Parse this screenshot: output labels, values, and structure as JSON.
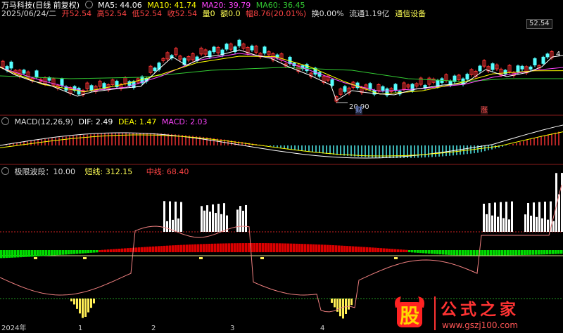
{
  "header": {
    "title": "万马科技(日线 前复权)",
    "ma": [
      {
        "label": "MA5: 44.06",
        "color": "#ffffff"
      },
      {
        "label": "MA10: 41.74",
        "color": "#ffff00"
      },
      {
        "label": "MA20: 39.79",
        "color": "#ff44ff"
      },
      {
        "label": "MA60: 36.45",
        "color": "#33cc33"
      }
    ]
  },
  "quote": {
    "date": "2025/06/24/二",
    "open": "开52.54",
    "high": "高52.54",
    "low": "低52.54",
    "close": "收52.54",
    "vol": "量0",
    "amt": "额0.0",
    "chg": "幅8.76(20.01%)",
    "turn": "换0.00%",
    "float": "流通1.19亿",
    "sector": "通信设备"
  },
  "price_panel": {
    "high_label": "52.54",
    "right_label": "4",
    "low_label": "20.90",
    "tag1": "财",
    "tag2": "涨"
  },
  "macd": {
    "title": "MACD(12,26,9)",
    "dif": "DIF: 2.49",
    "dea": "DEA: 1.47",
    "macd": "MACD: 2.03"
  },
  "bodong": {
    "title": "极限波段：10.00",
    "short": "短线: 312.15",
    "mid": "中线: 68.40"
  },
  "axis": {
    "labels": [
      "2024年",
      "1",
      "2",
      "3",
      "4"
    ]
  },
  "watermark": {
    "glyph": "股",
    "text": "公式之家",
    "url": "www.gszj100.com"
  },
  "colors": {
    "up": "#ff3333",
    "down": "#55ffff",
    "ma5": "#ffffff",
    "ma10": "#ffff00",
    "ma20": "#ff44ff",
    "ma60": "#33cc33",
    "bar_green": "#00dd00",
    "bar_red": "#dd0000",
    "short": "#f08080",
    "sep": "#8b1c1c"
  },
  "chart_data": {
    "type": "line",
    "title": "万马科技(日线 前复权)",
    "series": [
      {
        "name": "MA5",
        "last": 44.06
      },
      {
        "name": "MA10",
        "last": 41.74
      },
      {
        "name": "MA20",
        "last": 39.79
      },
      {
        "name": "MA60",
        "last": 36.45
      }
    ],
    "price_marks": {
      "high": 52.54,
      "low": 20.9
    },
    "macd": {
      "DIF": 2.49,
      "DEA": 1.47,
      "MACD": 2.03
    },
    "bodong": {
      "极限波段": 10.0,
      "短线": 312.15,
      "中线": 68.4
    },
    "x_tick_labels": [
      "2024年",
      "1",
      "2",
      "3",
      "4"
    ]
  }
}
